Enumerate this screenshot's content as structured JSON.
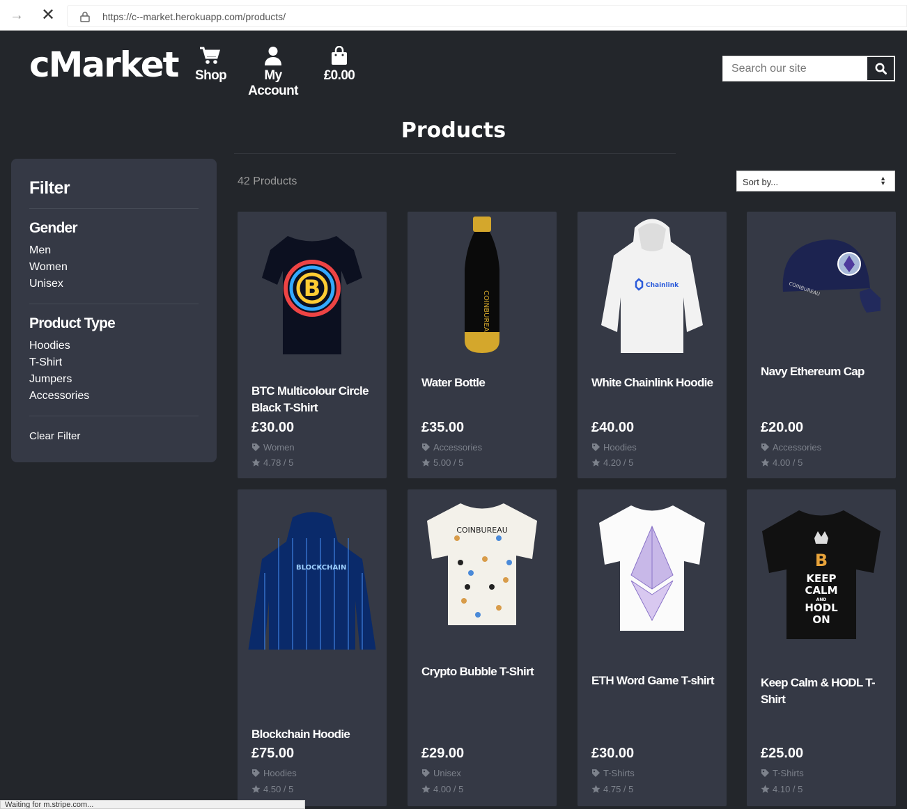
{
  "browser": {
    "url": "https://c--market.herokuapp.com/products/",
    "status_text": "Waiting for m.stripe.com..."
  },
  "header": {
    "logo": "cMarket",
    "nav": {
      "shop": "Shop",
      "account": "My Account",
      "bag": "£0.00"
    },
    "search_placeholder": "Search our site"
  },
  "page_title": "Products",
  "filter": {
    "title": "Filter",
    "gender_heading": "Gender",
    "gender": [
      "Men",
      "Women",
      "Unisex"
    ],
    "type_heading": "Product Type",
    "types": [
      "Hoodies",
      "T-Shirt",
      "Jumpers",
      "Accessories"
    ],
    "clear": "Clear Filter"
  },
  "listing": {
    "count": "42 Products",
    "sort": "Sort by..."
  },
  "products": [
    {
      "name": "BTC Multicolour Circle Black T-Shirt",
      "price": "£30.00",
      "category": "Women",
      "rating": "4.78 / 5"
    },
    {
      "name": "Water Bottle",
      "price": "£35.00",
      "category": "Accessories",
      "rating": "5.00 / 5"
    },
    {
      "name": "White Chainlink Hoodie",
      "price": "£40.00",
      "category": "Hoodies",
      "rating": "4.20 / 5"
    },
    {
      "name": "Navy Ethereum Cap",
      "price": "£20.00",
      "category": "Accessories",
      "rating": "4.00 / 5"
    },
    {
      "name": "Blockchain Hoodie",
      "price": "£75.00",
      "category": "Hoodies",
      "rating": "4.50 / 5"
    },
    {
      "name": "Crypto Bubble T-Shirt",
      "price": "£29.00",
      "category": "Unisex",
      "rating": "4.00 / 5"
    },
    {
      "name": "ETH Word Game T-shirt",
      "price": "£30.00",
      "category": "T-Shirts",
      "rating": "4.75 / 5"
    },
    {
      "name": "Keep Calm & HODL T-Shirt",
      "price": "£25.00",
      "category": "T-Shirts",
      "rating": "4.10 / 5"
    }
  ],
  "colors": {
    "page_bg": "#23262b",
    "panel_bg": "#353945",
    "muted_text": "#7d828c"
  }
}
